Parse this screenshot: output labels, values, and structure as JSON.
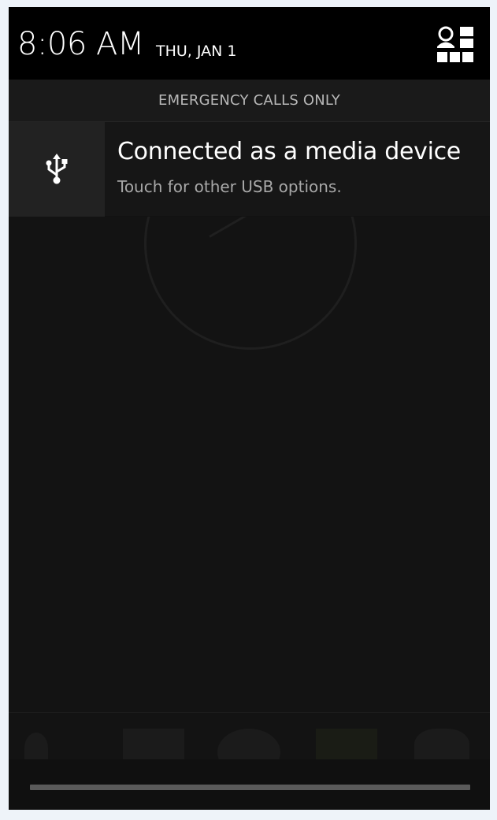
{
  "status_header": {
    "time": "8:06 AM",
    "date": "THU, JAN 1",
    "settings_icon": "quick-settings-icon"
  },
  "carrier_bar": {
    "text": "EMERGENCY CALLS ONLY"
  },
  "notification": {
    "icon": "usb-icon",
    "title": "Connected as a media device",
    "subtitle": "Touch for other USB options."
  },
  "colors": {
    "header_bg": "#000000",
    "panel_bg": "#131313",
    "notification_icon_bg": "#222222",
    "title_text": "#ffffff",
    "subtitle_text": "#a8a8a8",
    "handle": "#5a5a5a"
  }
}
